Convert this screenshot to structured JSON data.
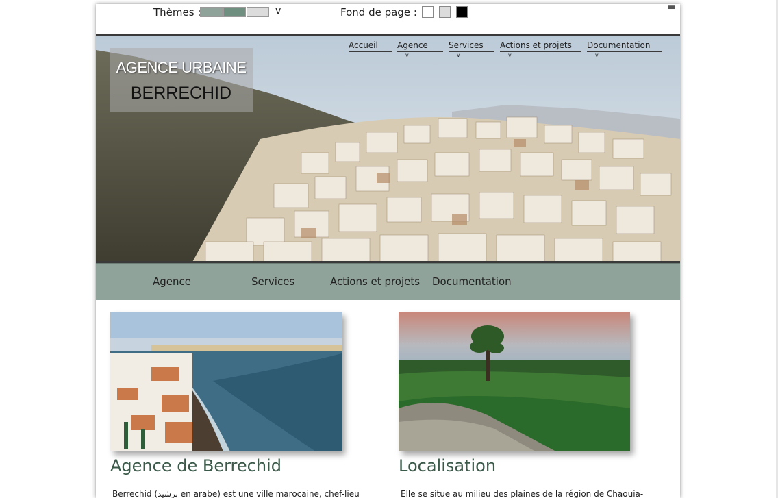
{
  "toolbar": {
    "themes_label": "Thèmes :",
    "themes_chevron": "v",
    "theme_swatches": [
      "#8fa39a",
      "#6f8f80",
      "#dcdcdc"
    ],
    "background_label": "Fond de page :",
    "background_options": [
      "#ffffff",
      "#dcdcdc",
      "#000000"
    ]
  },
  "header": {
    "logo_line1": "AGENCE URBAINE",
    "logo_line2": "BERRECHID"
  },
  "top_nav": {
    "items": [
      {
        "label": "Accueil",
        "caret": ""
      },
      {
        "label": "Agence",
        "caret": "v"
      },
      {
        "label": "Services",
        "caret": "v"
      },
      {
        "label": "Actions et projets",
        "caret": "v"
      },
      {
        "label": "Documentation",
        "caret": "v"
      }
    ]
  },
  "main_nav": {
    "items": [
      "Agence",
      "Services",
      "Actions et projets",
      "Documentation"
    ]
  },
  "cards": [
    {
      "title": "Agence de Berrechid",
      "text": "Berrechid (برشيد en arabe) est une ville marocaine, chef-lieu"
    },
    {
      "title": "Localisation",
      "text": "Elle se situe au milieu des plaines de la région de Chaouia-"
    }
  ],
  "colors": {
    "nav_bar": "#8fa39a",
    "title_green": "#3b5a4a"
  }
}
